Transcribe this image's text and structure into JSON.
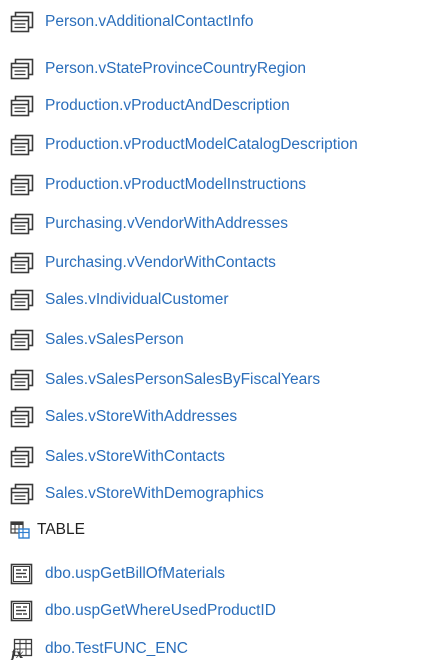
{
  "views": [
    {
      "label": "Person.vAdditionalContactInfo",
      "icon": "view-icon"
    },
    {
      "label": "Person.vStateProvinceCountryRegion",
      "icon": "view-icon"
    },
    {
      "label": "Production.vProductAndDescription",
      "icon": "view-icon"
    },
    {
      "label": "Production.vProductModelCatalogDescription",
      "icon": "view-icon"
    },
    {
      "label": "Production.vProductModelInstructions",
      "icon": "view-icon"
    },
    {
      "label": "Purchasing.vVendorWithAddresses",
      "icon": "view-icon"
    },
    {
      "label": "Purchasing.vVendorWithContacts",
      "icon": "view-icon"
    },
    {
      "label": "Sales.vIndividualCustomer",
      "icon": "view-icon"
    },
    {
      "label": "Sales.vSalesPerson",
      "icon": "view-icon"
    },
    {
      "label": "Sales.vSalesPersonSalesByFiscalYears",
      "icon": "view-icon"
    },
    {
      "label": "Sales.vStoreWithAddresses",
      "icon": "view-icon"
    },
    {
      "label": "Sales.vStoreWithContacts",
      "icon": "view-icon"
    },
    {
      "label": "Sales.vStoreWithDemographics",
      "icon": "view-icon"
    }
  ],
  "table_type": {
    "label": "TABLE",
    "icon": "table-type-icon"
  },
  "procedures": [
    {
      "label": "dbo.uspGetBillOfMaterials",
      "icon": "stored-procedure-icon"
    },
    {
      "label": "dbo.uspGetWhereUsedProductID",
      "icon": "stored-procedure-icon"
    }
  ],
  "functions": [
    {
      "label": "dbo.TestFUNC_ENC",
      "icon": "function-icon"
    }
  ],
  "colors": {
    "link": "#2a6ebb",
    "icon_dark": "#3a3a3a",
    "icon_blue": "#2f7fd0",
    "background": "#ffffff"
  }
}
